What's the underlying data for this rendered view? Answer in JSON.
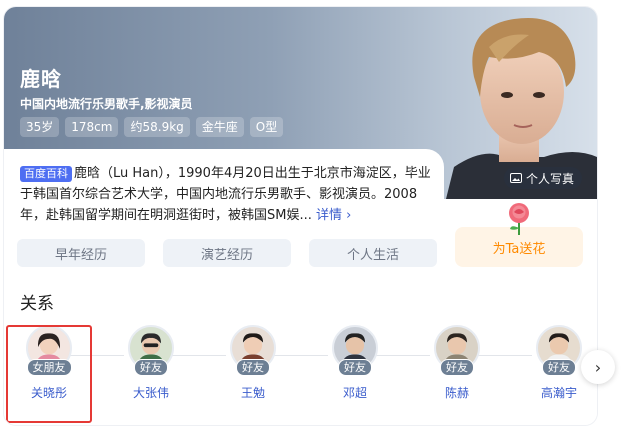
{
  "person": {
    "name": "鹿晗",
    "subtitle": "中国内地流行乐男歌手,影视演员",
    "tags": [
      "35岁",
      "178cm",
      "约58.9kg",
      "金牛座",
      "O型"
    ],
    "photos_label": "个人写真"
  },
  "bio": {
    "badge": "百度百科",
    "text": "鹿晗（Lu Han），1990年4月20日出生于北京市海淀区，毕业于韩国首尔综合艺术大学，中国内地流行乐男歌手、影视演员。2008年，赴韩国留学期间在明洞逛街时，被韩国SM娱...",
    "more_label": "详情 ›"
  },
  "chips": [
    "早年经历",
    "演艺经历",
    "个人生活"
  ],
  "gift": {
    "label": "为Ta送花"
  },
  "relations": {
    "title": "关系",
    "items": [
      {
        "name": "关晓彤",
        "relation": "女朋友"
      },
      {
        "name": "大张伟",
        "relation": "好友"
      },
      {
        "name": "王勉",
        "relation": "好友"
      },
      {
        "name": "邓超",
        "relation": "好友"
      },
      {
        "name": "陈赫",
        "relation": "好友"
      },
      {
        "name": "高瀚宇",
        "relation": "好友"
      }
    ],
    "next_icon": "chevron-right-icon"
  },
  "colors": {
    "hero_start": "#6f8199",
    "link": "#3a5ccc",
    "badge_blue": "#4e6ef2",
    "gift_orange": "#ff8a00",
    "highlight": "#e53935"
  }
}
